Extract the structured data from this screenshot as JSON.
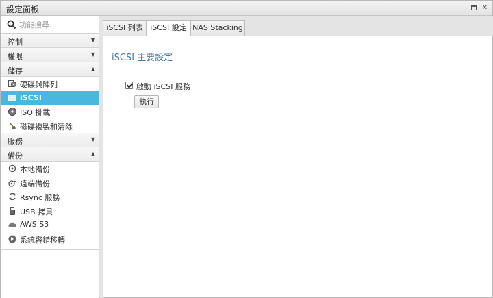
{
  "window": {
    "title": "設定面板",
    "maximize_icon": "maximize-icon",
    "close_icon": "close-icon"
  },
  "sidebar": {
    "search": {
      "placeholder": "功能搜尋...",
      "icon": "search-icon"
    },
    "sections": [
      {
        "label": "控制",
        "expanded": false
      },
      {
        "label": "權限",
        "expanded": false
      },
      {
        "label": "儲存",
        "expanded": true,
        "items": [
          {
            "label": "硬碟與陣列",
            "icon": "disk-array-icon"
          },
          {
            "label": "iSCSI",
            "icon": "iscsi-icon",
            "selected": true
          },
          {
            "label": "ISO 掛載",
            "icon": "iso-disc-icon"
          },
          {
            "label": "磁碟複製和清除",
            "icon": "broom-icon"
          }
        ]
      },
      {
        "label": "服務",
        "expanded": false
      },
      {
        "label": "備份",
        "expanded": true,
        "items": [
          {
            "label": "本地備份",
            "icon": "local-backup-icon"
          },
          {
            "label": "遠端備份",
            "icon": "remote-backup-icon"
          },
          {
            "label": "Rsync 服務",
            "icon": "sync-icon"
          },
          {
            "label": "USB 拷貝",
            "icon": "usb-icon"
          },
          {
            "label": "AWS S3",
            "icon": "cloud-icon"
          },
          {
            "label": "系統容錯移轉",
            "icon": "failover-icon"
          }
        ]
      }
    ]
  },
  "tabs": [
    {
      "label": "iSCSI 列表",
      "active": false
    },
    {
      "label": "iSCSI 設定",
      "active": true
    },
    {
      "label": "NAS Stacking",
      "active": false
    }
  ],
  "panel": {
    "title": "iSCSI 主要設定",
    "enable_checkbox": {
      "label": "啟動 iSCSI 服務",
      "checked": true
    },
    "execute_button": "執行"
  },
  "colors": {
    "selected_item": "#4ab7df",
    "panel_title": "#4a77a3"
  }
}
